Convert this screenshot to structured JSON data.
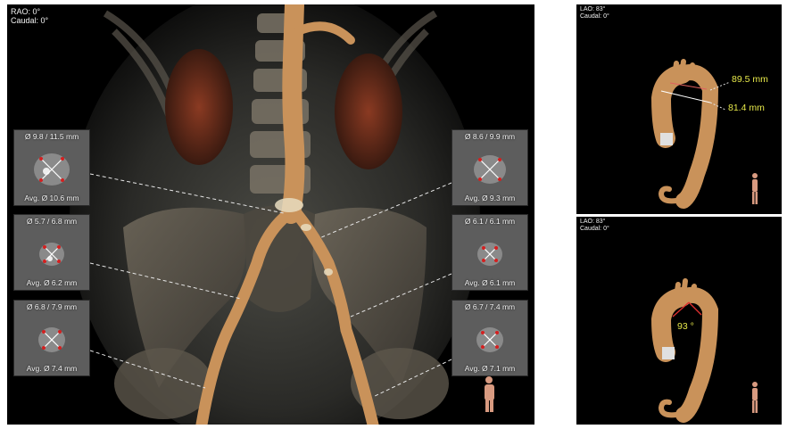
{
  "main_view": {
    "orientation_label": "RAO: 0°\nCaudal: 0°",
    "insets_left": [
      {
        "top": "Ø 9.8 / 11.5 mm",
        "bottom": "Avg. Ø 10.6 mm"
      },
      {
        "top": "Ø 5.7 / 6.8 mm",
        "bottom": "Avg. Ø 6.2 mm"
      },
      {
        "top": "Ø 6.8 / 7.9 mm",
        "bottom": "Avg. Ø 7.4 mm"
      }
    ],
    "insets_right": [
      {
        "top": "Ø 8.6 / 9.9 mm",
        "bottom": "Avg. Ø 9.3 mm"
      },
      {
        "top": "Ø 6.1 / 6.1 mm",
        "bottom": "Avg. Ø 6.1 mm"
      },
      {
        "top": "Ø 6.7 / 7.4 mm",
        "bottom": "Avg. Ø 7.1 mm"
      }
    ]
  },
  "top_right_view": {
    "orientation_label": "LAO: 83°\nCaudal: 0°",
    "measurement_1": "89.5 mm",
    "measurement_2": "81.4 mm"
  },
  "bottom_right_view": {
    "orientation_label": "LAO: 83°\nCaudal: 0°",
    "angle": "93 °"
  },
  "colors": {
    "vessel": "#c9925a",
    "measurement_text": "#e6e84a",
    "marker": "#d42020",
    "background": "#000000"
  }
}
